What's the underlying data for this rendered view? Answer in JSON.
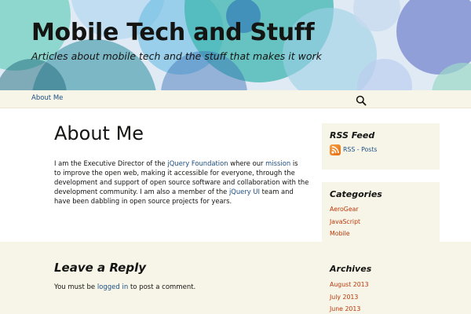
{
  "site": {
    "title": "Mobile Tech and Stuff",
    "description": "Articles about mobile tech and the stuff that makes it work"
  },
  "nav": {
    "items": [
      {
        "label": "About Me"
      }
    ],
    "search_icon": "search-icon"
  },
  "article": {
    "title": "About Me",
    "content_lines": [
      {
        "before": "I am the Executive Director of the ",
        "link1": "jQuery Foundation",
        "middle": " where our ",
        "link2": "mission",
        "after": " is"
      },
      {
        "text": "to improve the open web, making it accessible for everyone, through the"
      },
      {
        "text": "development and support of open source software and collaboration with the"
      },
      {
        "before": "development community. I am also a member of the ",
        "link": "jQuery UI",
        "after": " team and"
      },
      {
        "text": "have been dabbling in open source projects for years."
      }
    ]
  },
  "comments": {
    "title": "Leave a Reply",
    "must_login_before": "You must be ",
    "must_login_link": "logged in",
    "must_login_after": " to post a comment."
  },
  "sidebar": {
    "rss": {
      "title": "RSS Feed",
      "link": "RSS - Posts",
      "icon": "rss-icon"
    },
    "categories": {
      "title": "Categories",
      "items": [
        "AeroGear",
        "JavaScript",
        "Mobile"
      ]
    },
    "archives": {
      "title": "Archives",
      "items": [
        "August 2013",
        "July 2013",
        "June 2013"
      ]
    }
  },
  "colors": {
    "link_blue": "#1c4e84",
    "link_orange": "#bc360a",
    "widget_bg": "#f7f5e7",
    "text": "#141412"
  }
}
